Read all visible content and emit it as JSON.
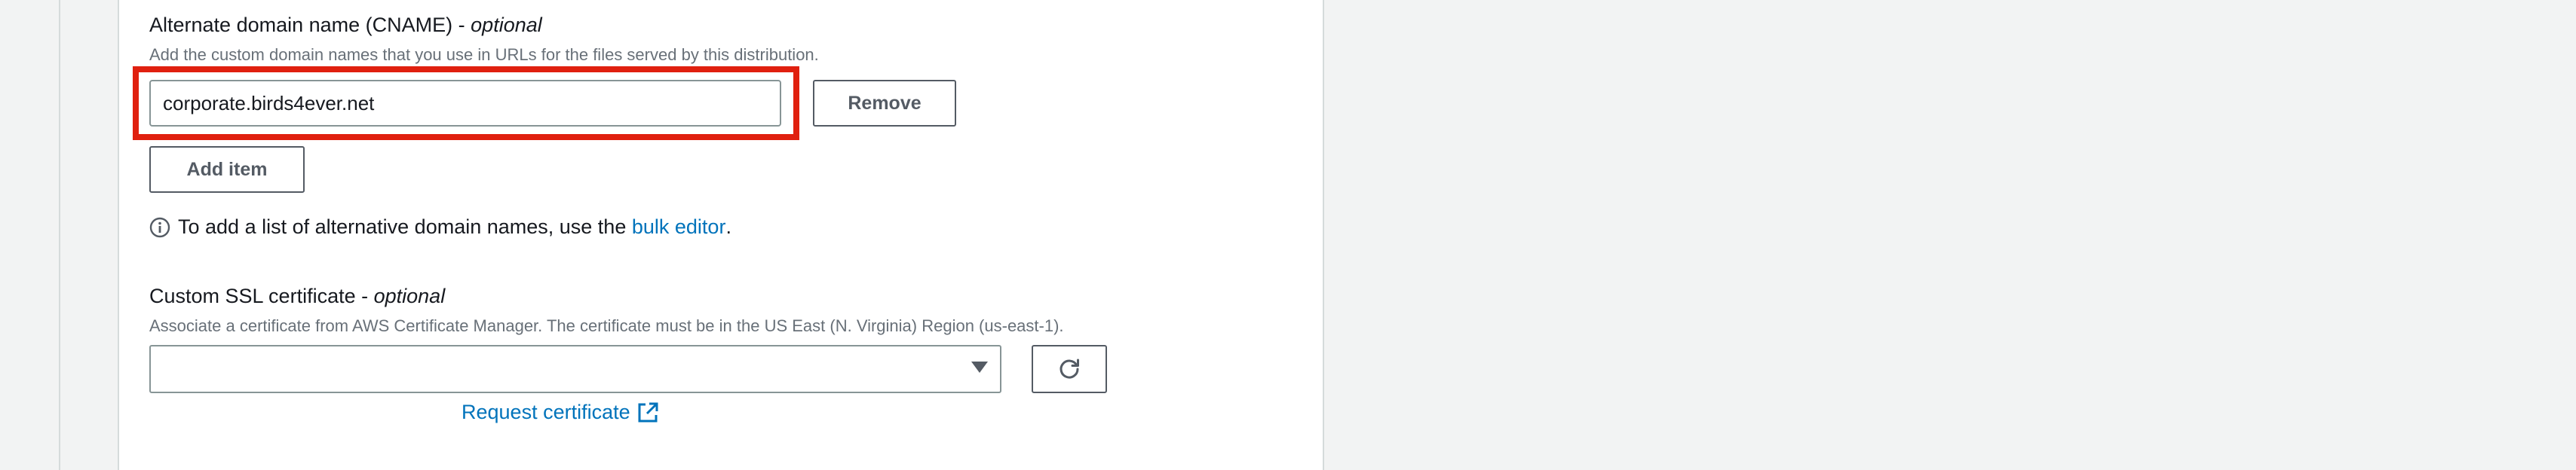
{
  "cname": {
    "label": "Alternate domain name (CNAME)",
    "label_suffix": "optional",
    "description": "Add the custom domain names that you use in URLs for the files served by this distribution.",
    "value": "corporate.birds4ever.net",
    "remove_label": "Remove",
    "add_item_label": "Add item",
    "info_prefix": "To add a list of alternative domain names, use the ",
    "info_link": "bulk editor",
    "info_suffix": "."
  },
  "ssl": {
    "label": "Custom SSL certificate",
    "label_suffix": "optional",
    "description": "Associate a certificate from AWS Certificate Manager. The certificate must be in the US East (N. Virginia) Region (us-east-1).",
    "selected": "",
    "request_label": "Request certificate"
  },
  "icons": {
    "info": "info-icon",
    "dropdown": "caret-down-icon",
    "refresh": "refresh-icon",
    "external": "external-link-icon"
  },
  "colors": {
    "highlight": "#e0200f",
    "link": "#0073bb"
  }
}
